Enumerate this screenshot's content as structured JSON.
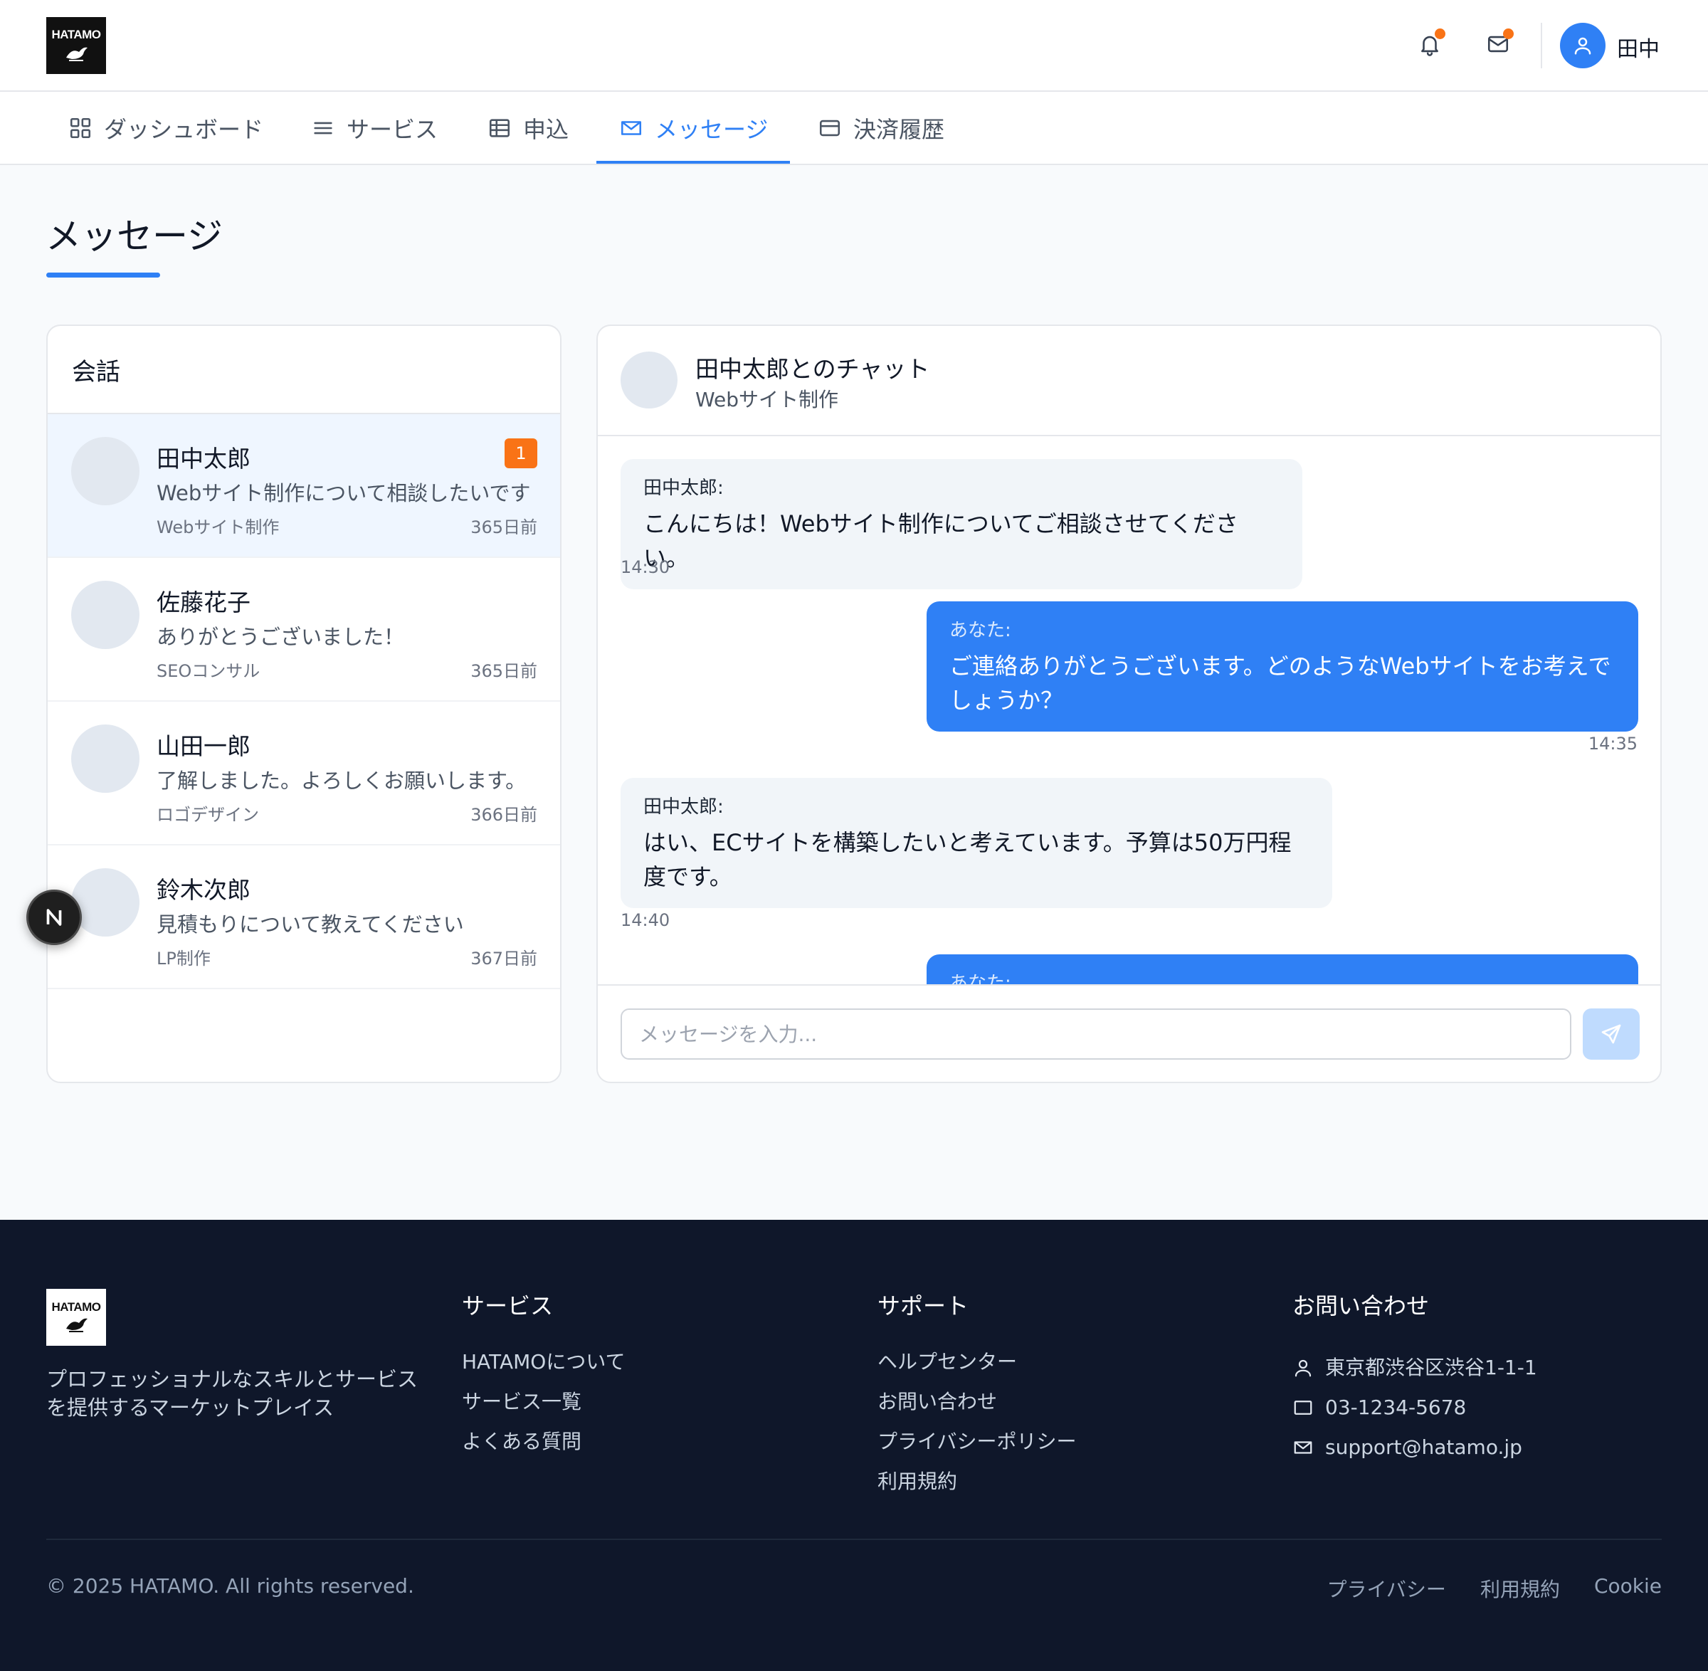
{
  "brand": {
    "logo_text": "HATAMO"
  },
  "header": {
    "icons": [
      "bell-icon",
      "mail-icon",
      "user-icon"
    ],
    "user_name": "田中",
    "notification_dot_color": "#f97316"
  },
  "nav": {
    "items": [
      {
        "label": "ダッシュボード",
        "icon": "grid-icon"
      },
      {
        "label": "サービス",
        "icon": "list-icon"
      },
      {
        "label": "申込",
        "icon": "table-icon"
      },
      {
        "label": "メッセージ",
        "icon": "mail-icon",
        "active": true
      },
      {
        "label": "決済履歴",
        "icon": "card-icon"
      }
    ]
  },
  "page": {
    "title": "メッセージ"
  },
  "conversations": {
    "heading": "会話",
    "items": [
      {
        "name": "田中太郎",
        "badge": "1",
        "preview": "Webサイト制作について相談したいです",
        "service": "Webサイト制作",
        "time": "365日前",
        "selected": true
      },
      {
        "name": "佐藤花子",
        "badge": "",
        "preview": "ありがとうございました！",
        "service": "SEOコンサル",
        "time": "365日前"
      },
      {
        "name": "山田一郎",
        "badge": "",
        "preview": "了解しました。よろしくお願いします。",
        "service": "ロゴデザイン",
        "time": "366日前"
      },
      {
        "name": "鈴木次郎",
        "badge": "",
        "preview": "見積もりについて教えてください",
        "service": "LP制作",
        "time": "367日前"
      }
    ]
  },
  "chat": {
    "title": "田中太郎とのチャット",
    "subtitle": "Webサイト制作",
    "messages": [
      {
        "sender": "田中太郎:",
        "text": "こんにちは！Webサイト制作についてご相談させてください。",
        "time": "14:30",
        "mine": false
      },
      {
        "sender": "あなた:",
        "text": "ご連絡ありがとうございます。どのようなWebサイトをお考えでしょうか？",
        "time": "14:35",
        "mine": true
      },
      {
        "sender": "田中太郎:",
        "text": "はい、ECサイトを構築したいと考えています。予算は50万円程度です。",
        "time": "14:40",
        "mine": false
      },
      {
        "sender": "あなた:",
        "text": "",
        "time": "",
        "mine": true
      }
    ],
    "input_placeholder": "メッセージを入力...",
    "send_icon": "send-icon"
  },
  "dev_badge": {
    "label": "N"
  },
  "footer": {
    "logo_text": "HATAMO",
    "tagline": "プロフェッショナルなスキルとサービスを提供するマーケットプレイス",
    "columns": {
      "services": {
        "title": "サービス",
        "links": [
          "HATAMOについて",
          "サービス一覧",
          "よくある質問"
        ]
      },
      "support": {
        "title": "サポート",
        "links": [
          "ヘルプセンター",
          "お問い合わせ",
          "プライバシーポリシー",
          "利用規約"
        ]
      },
      "contact": {
        "title": "お問い合わせ",
        "items": [
          {
            "icon": "location-icon",
            "text": "東京都渋谷区渋谷1-1-1"
          },
          {
            "icon": "phone-icon",
            "text": "03-1234-5678"
          },
          {
            "icon": "mail-icon",
            "text": "support@hatamo.jp"
          }
        ]
      }
    },
    "copyright": "© 2025 HATAMO. All rights reserved.",
    "bottom_links": [
      "プライバシー",
      "利用規約",
      "Cookie"
    ]
  },
  "colors": {
    "accent": "#2f80f5",
    "badge": "#f97316",
    "footer_bg": "#0f172a",
    "page_bg": "#f8fafc"
  }
}
